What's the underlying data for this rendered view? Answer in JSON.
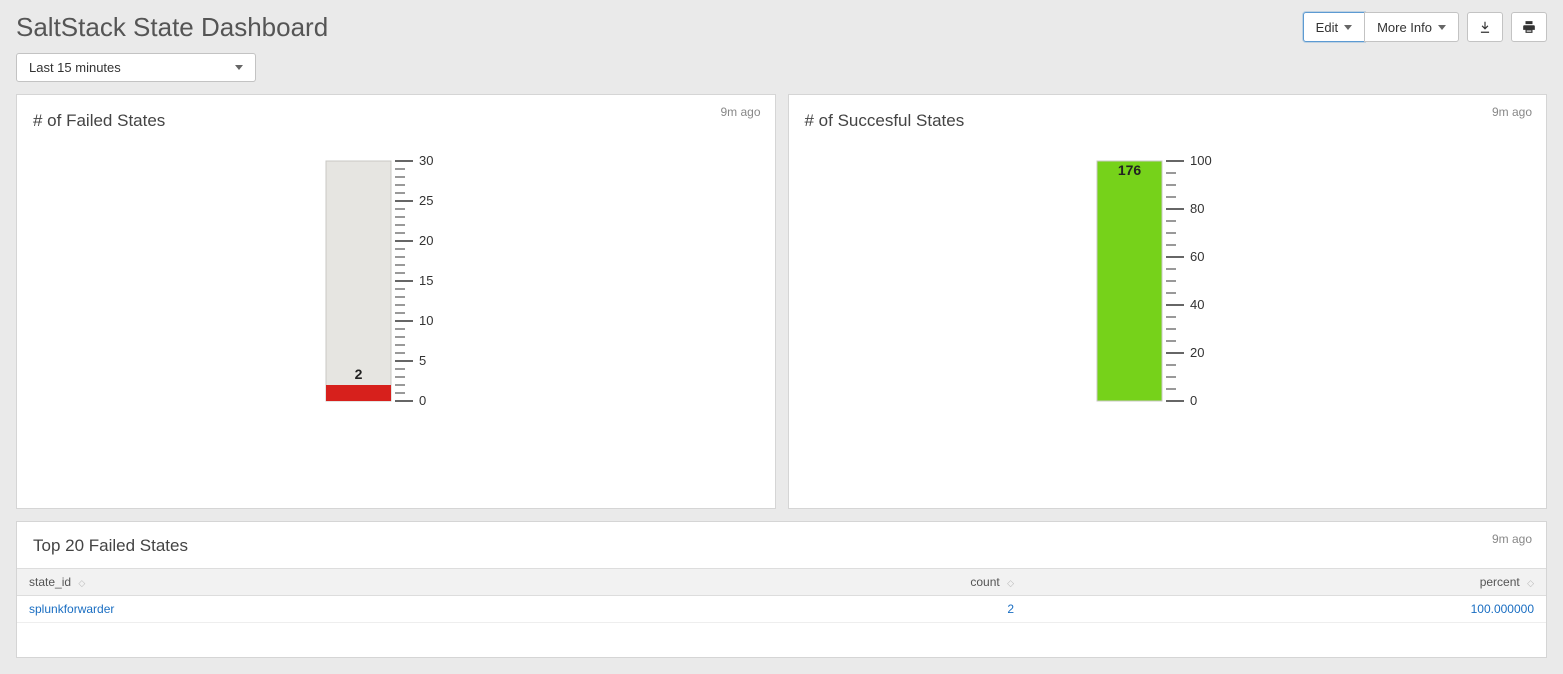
{
  "header": {
    "title": "SaltStack State Dashboard",
    "edit_label": "Edit",
    "more_info_label": "More Info"
  },
  "time_picker": {
    "label": "Last 15 minutes"
  },
  "panels": {
    "failed": {
      "title": "# of Failed States",
      "ago": "9m ago"
    },
    "success": {
      "title": "# of Succesful States",
      "ago": "9m ago"
    },
    "top20": {
      "title": "Top 20 Failed States",
      "ago": "9m ago"
    }
  },
  "table": {
    "cols": {
      "state_id": "state_id",
      "count": "count",
      "percent": "percent"
    },
    "rows": [
      {
        "state_id": "splunkforwarder",
        "count": "2",
        "percent": "100.000000"
      }
    ]
  },
  "chart_data": [
    {
      "type": "gauge",
      "name": "failed",
      "value": 2,
      "ylim": [
        0,
        30
      ],
      "major_ticks": [
        0,
        5,
        10,
        15,
        20,
        25,
        30
      ],
      "minor_step": 1,
      "fill_color": "#d7201c",
      "track_color": "#e6e5e1",
      "label_inside": "2"
    },
    {
      "type": "gauge",
      "name": "success",
      "value": 176,
      "ylim": [
        0,
        100
      ],
      "major_ticks": [
        0,
        20,
        40,
        60,
        80,
        100
      ],
      "minor_step": 5,
      "fill_color": "#76d21a",
      "track_color": "#76d21a",
      "label_inside": "176"
    }
  ]
}
